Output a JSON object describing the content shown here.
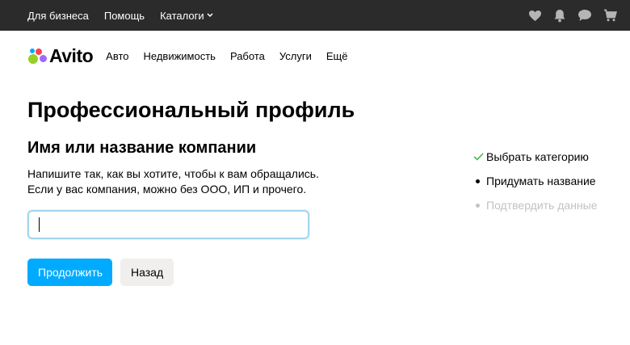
{
  "topbar": {
    "links": [
      "Для бизнеса",
      "Помощь"
    ],
    "catalog_label": "Каталоги",
    "icons": [
      "heart-icon",
      "bell-icon",
      "chat-icon",
      "cart-icon"
    ]
  },
  "nav": {
    "logo_text": "Avito",
    "items": [
      "Авто",
      "Недвижимость",
      "Работа",
      "Услуги",
      "Ещё"
    ]
  },
  "main": {
    "title": "Профессиональный профиль",
    "subtitle": "Имя или название компании",
    "desc_line1": "Напишите так, как вы хотите, чтобы к вам обращались.",
    "desc_line2": "Если у вас компания, можно без ООО, ИП и прочего.",
    "input_value": "",
    "continue_label": "Продолжить",
    "back_label": "Назад"
  },
  "steps": [
    {
      "label": "Выбрать категорию",
      "state": "done"
    },
    {
      "label": "Придумать название",
      "state": "current"
    },
    {
      "label": "Подтвердить данные",
      "state": "pending"
    }
  ],
  "colors": {
    "topbar_bg": "#2b2b2b",
    "primary": "#00aaff",
    "check": "#49b64e",
    "pending_text": "#c2c2c2",
    "logo_green": "#97cf26",
    "logo_blue": "#00aaff",
    "logo_red": "#ff4053",
    "logo_purple": "#a169f7"
  }
}
